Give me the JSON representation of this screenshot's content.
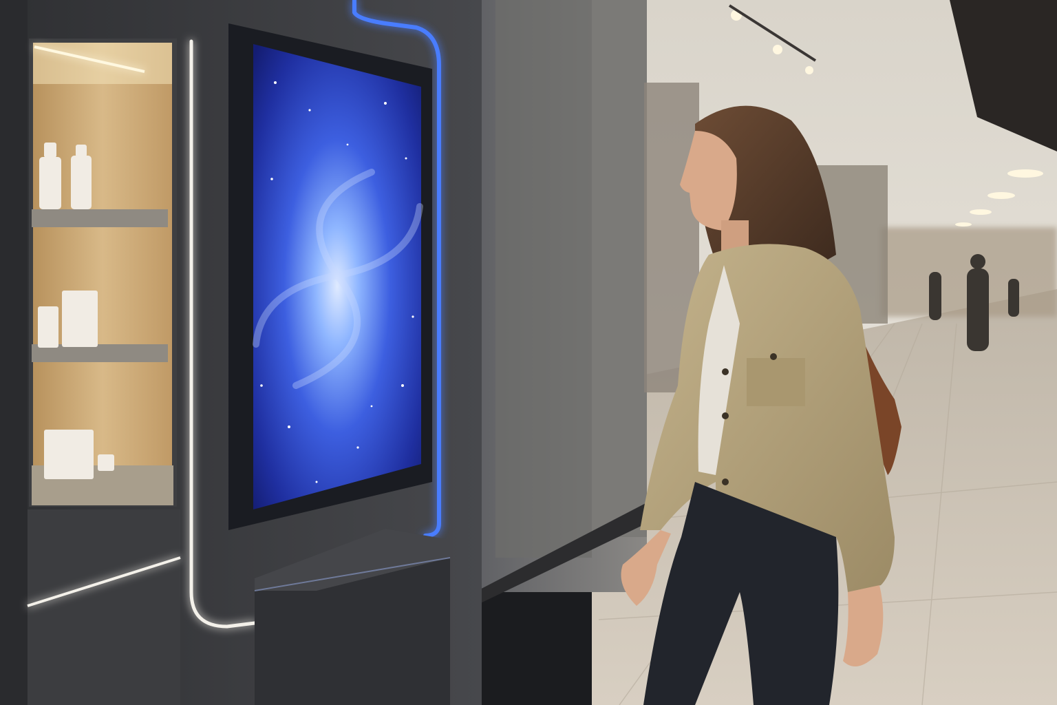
{
  "scene": {
    "description_hidden": false,
    "colors": {
      "wall_dark": "#3a3b3e",
      "wall_mid": "#55565a",
      "shelf_wood": "#c9a877",
      "shelf_light": "#f2e2b8",
      "screen_deep": "#1a2a8a",
      "screen_core": "#8fb6ff",
      "neon_blue": "#4a7dff",
      "neon_white": "#f4f1ea",
      "corridor_ceiling": "#e8e4dc",
      "corridor_floor": "#cfc6b8",
      "jacket": "#b3a27c",
      "jeans": "#22252c",
      "hair": "#5b3f2c",
      "skin": "#d9a98a",
      "bag_strap": "#7a4528"
    }
  }
}
